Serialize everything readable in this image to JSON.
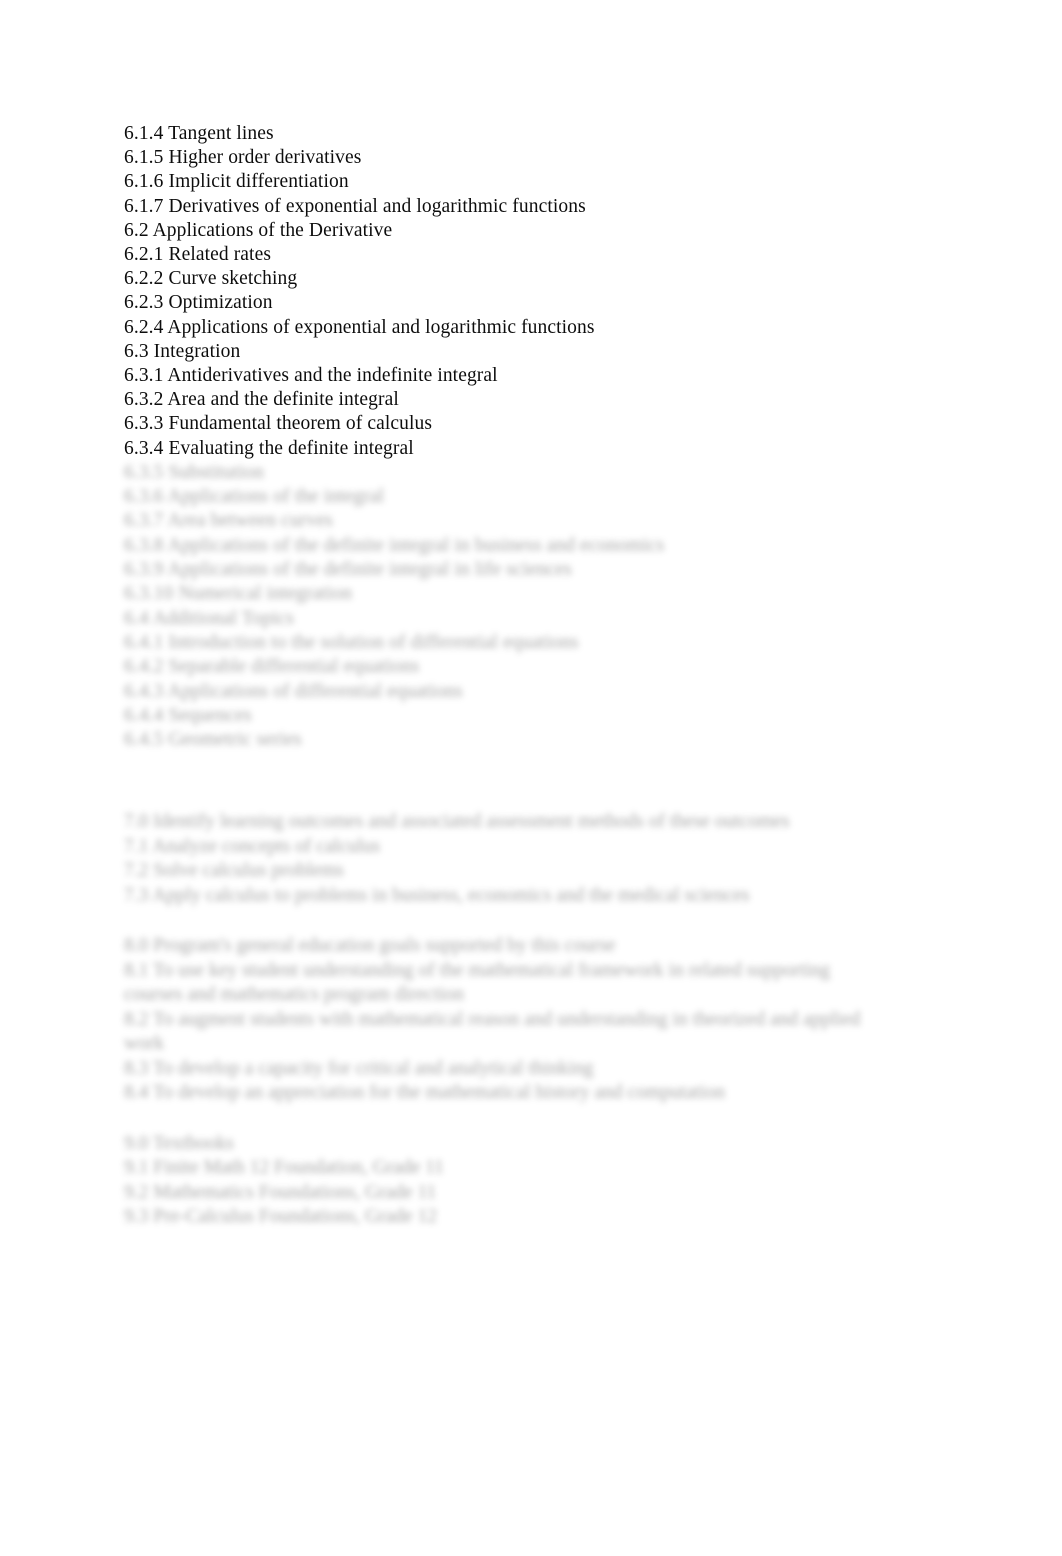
{
  "document": {
    "page_background": "#ffffff",
    "text_color": "#0d0d0d",
    "blur_text_color": "#6f6f6f"
  },
  "outline_sharp": {
    "lines": [
      "6.1.4 Tangent lines",
      "6.1.5 Higher order derivatives",
      "6.1.6 Implicit differentiation",
      "6.1.7 Derivatives of exponential and logarithmic functions",
      "6.2 Applications of the Derivative",
      "6.2.1 Related rates",
      "6.2.2 Curve sketching",
      "6.2.3 Optimization",
      "6.2.4 Applications of exponential and logarithmic functions",
      "6.3 Integration",
      "6.3.1 Antiderivatives and the indefinite integral",
      "6.3.2 Area and the definite integral",
      "6.3.3 Fundamental theorem of calculus",
      "6.3.4 Evaluating the definite integral"
    ]
  },
  "outline_blurred": {
    "lines": [
      "6.3.5 Substitution",
      "6.3.6 Applications of the integral",
      "6.3.7 Area between curves",
      "6.3.8 Applications of the definite integral in business and economics",
      "6.3.9 Applications of the definite integral in life sciences",
      "6.3.10 Numerical integration",
      "6.4 Additional Topics",
      "6.4.1 Introduction to the solution of differential equations",
      "6.4.2 Separable differential equations",
      "6.4.3 Applications of differential equations",
      "6.4.4 Sequences",
      "6.4.5 Geometric series"
    ]
  },
  "paragraph_block_one": {
    "lines": [
      "7.0      Identify learning outcomes and associated assessment methods of these outcomes",
      "7.1  Analyze concepts of calculus",
      "7.2  Solve calculus problems",
      "7.3  Apply calculus to problems in business, economics and the medical sciences"
    ]
  },
  "paragraph_block_two": {
    "lines": [
      "8.0      Program's general education goals supported by this course",
      "8.1  To use key student understanding of the mathematical framework in related supporting courses and mathematics program direction",
      "8.2  To augment students with mathematical reason and understanding in theorized and applied work",
      "8.3  To develop a capacity for critical and analytical thinking",
      "8.4  To develop an appreciation for the mathematical history and computation"
    ]
  },
  "paragraph_block_three": {
    "lines": [
      "9.0      Textbooks",
      "9.1  Finite Math 12 Foundation, Grade 11",
      "9.2  Mathematics Foundations, Grade 11",
      "9.3  Pre-Calculus Foundations, Grade 12"
    ]
  }
}
